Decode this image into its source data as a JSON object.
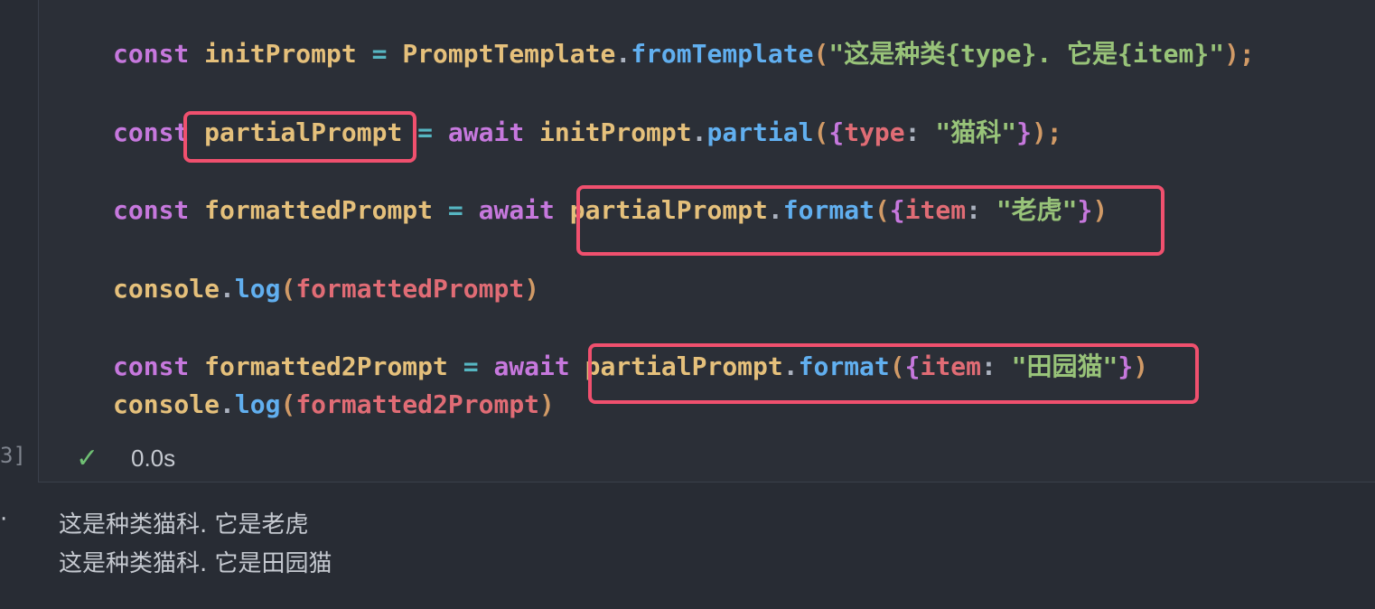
{
  "code": {
    "line1": {
      "const": "const",
      "name": "initPrompt",
      "eq": "=",
      "obj": "PromptTemplate",
      "dot": ".",
      "method": "fromTemplate",
      "open": "(",
      "arg": "\"这是种类{type}. 它是{item}\"",
      "close": ");"
    },
    "line2": {
      "const": "const",
      "name": "partialPrompt",
      "eq": "=",
      "await": "await",
      "obj": "initPrompt",
      "dot": ".",
      "method": "partial",
      "open": "(",
      "brace_open": "{",
      "key": "type",
      "colon": ":",
      "value": "\"猫科\"",
      "brace_close": "}",
      "close": ");"
    },
    "line3": {
      "const": "const",
      "name": "formattedPrompt",
      "eq": "=",
      "await": "await",
      "obj": "partialPrompt",
      "dot": ".",
      "method": "format",
      "open": "(",
      "brace_open": "{",
      "key": "item",
      "colon": ":",
      "value": "\"老虎\"",
      "brace_close": "}",
      "close": ")"
    },
    "line4": {
      "obj": "console",
      "dot": ".",
      "method": "log",
      "open": "(",
      "arg": "formattedPrompt",
      "close": ")"
    },
    "line5": {
      "const": "const",
      "name": "formatted2Prompt",
      "eq": "=",
      "await": "await",
      "obj": "partialPrompt",
      "dot": ".",
      "method": "format",
      "open": "(",
      "brace_open": "{",
      "key": "item",
      "colon": ":",
      "value": "\"田园猫\"",
      "brace_close": "}",
      "close": ")"
    },
    "line6": {
      "obj": "console",
      "dot": ".",
      "method": "log",
      "open": "(",
      "arg": "formatted2Prompt",
      "close": ")"
    }
  },
  "cell": {
    "exec_count": "3]",
    "status_icon": "✓",
    "duration": "0.0s",
    "output_marker": "·"
  },
  "output": {
    "lines": [
      "这是种类猫科. 它是老虎",
      "这是种类猫科. 它是田园猫"
    ]
  },
  "colors": {
    "background": "#282c34",
    "keyword": "#c678dd",
    "variable": "#e5c07b",
    "function": "#61afef",
    "string": "#98c379",
    "property": "#e06c75",
    "highlight_box": "#f0506e",
    "success": "#6fbf73"
  }
}
